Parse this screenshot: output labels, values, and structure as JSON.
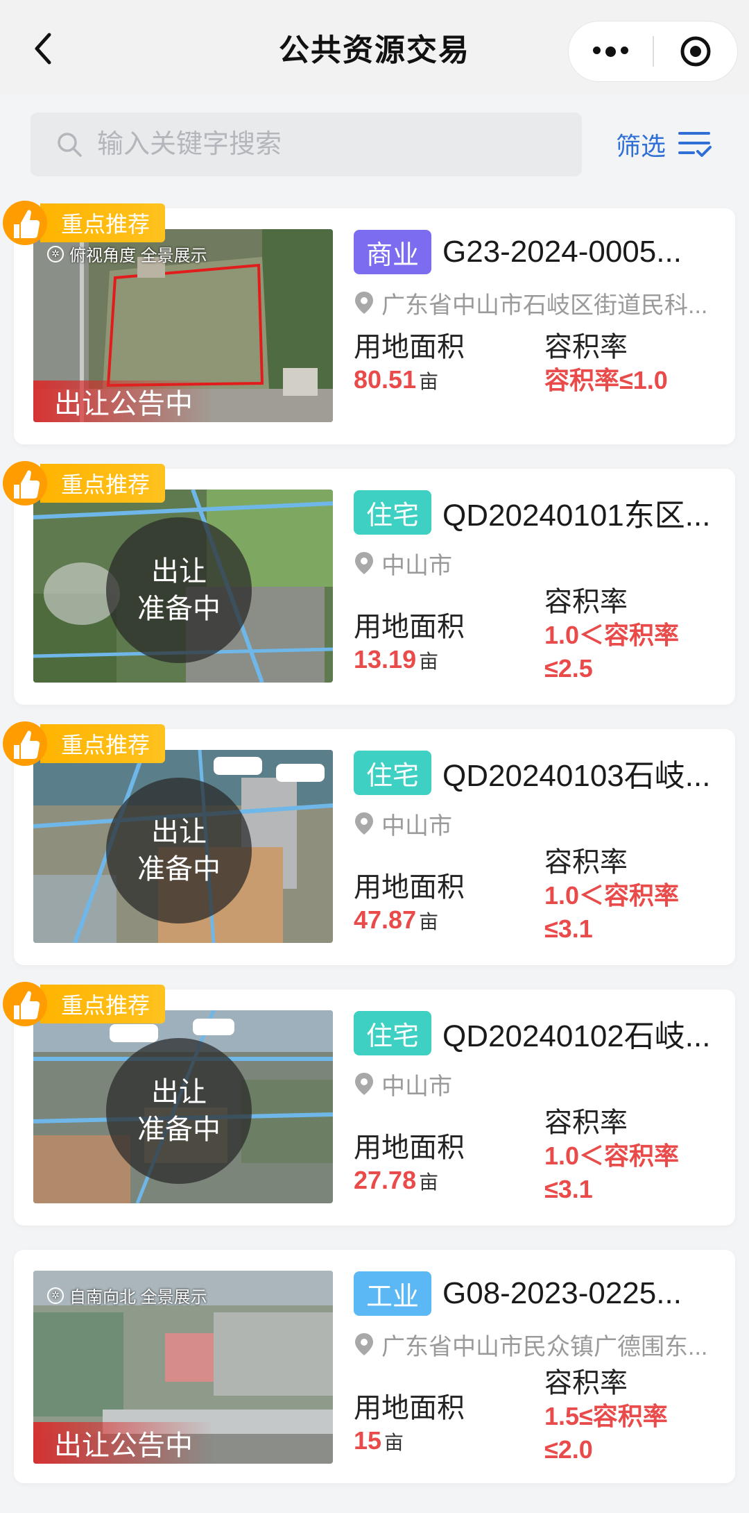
{
  "header": {
    "title": "公共资源交易"
  },
  "search": {
    "placeholder": "输入关键字搜索",
    "filter_label": "筛选"
  },
  "colors": {
    "accent_blue": "#2f6fd6",
    "value_red": "#e94a4a",
    "tag_commercial": "#7b6cf0",
    "tag_residential": "#3fd0c4",
    "tag_industrial": "#5bb8f5",
    "ribbon_yellow": "#ffb400"
  },
  "listings": [
    {
      "featured": "重点推荐",
      "thumb_caption": "俯视角度 全景展示",
      "status": "出让公告中",
      "tag": "商业",
      "code": "G23-2024-0005...",
      "location": "广东省中山市石岐区街道民科...",
      "area_label": "用地面积",
      "area_value": "80.51",
      "area_unit": "亩",
      "ratio_label": "容积率",
      "ratio_value": "容积率≤1.0"
    },
    {
      "featured": "重点推荐",
      "status_line1": "出让",
      "status_line2": "准备中",
      "tag": "住宅",
      "code": "QD20240101东区...",
      "location": "中山市",
      "area_label": "用地面积",
      "area_value": "13.19",
      "area_unit": "亩",
      "ratio_label": "容积率",
      "ratio_value_line1": "1.0＜容积率",
      "ratio_value_line2": "≤2.5"
    },
    {
      "featured": "重点推荐",
      "status_line1": "出让",
      "status_line2": "准备中",
      "tag": "住宅",
      "code": "QD20240103石岐...",
      "location": "中山市",
      "area_label": "用地面积",
      "area_value": "47.87",
      "area_unit": "亩",
      "ratio_label": "容积率",
      "ratio_value_line1": "1.0＜容积率",
      "ratio_value_line2": "≤3.1"
    },
    {
      "featured": "重点推荐",
      "status_line1": "出让",
      "status_line2": "准备中",
      "tag": "住宅",
      "code": "QD20240102石岐...",
      "location": "中山市",
      "area_label": "用地面积",
      "area_value": "27.78",
      "area_unit": "亩",
      "ratio_label": "容积率",
      "ratio_value_line1": "1.0＜容积率",
      "ratio_value_line2": "≤3.1"
    },
    {
      "thumb_caption": "自南向北 全景展示",
      "status": "出让公告中",
      "tag": "工业",
      "code": "G08-2023-0225...",
      "location": "广东省中山市民众镇广德围东...",
      "area_label": "用地面积",
      "area_value": "15",
      "area_unit": "亩",
      "ratio_label": "容积率",
      "ratio_value_line1": "1.5≤容积率",
      "ratio_value_line2": "≤2.0"
    }
  ]
}
